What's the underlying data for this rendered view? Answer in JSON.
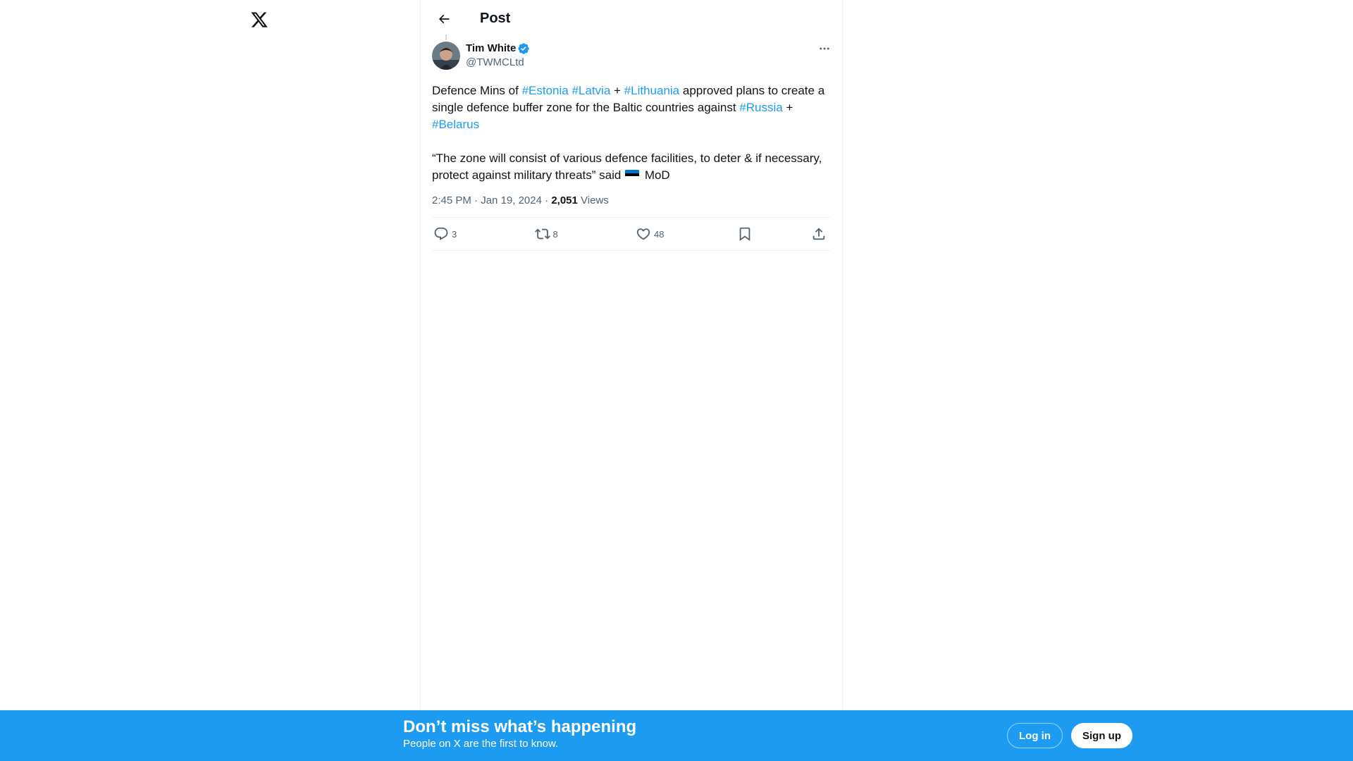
{
  "topbar": {
    "title": "Post"
  },
  "post": {
    "author": {
      "name": "Tim White",
      "handle": "@TWMCLtd"
    },
    "paragraph1": [
      {
        "text": "Defence Mins of ",
        "hashtag": false
      },
      {
        "text": "#Estonia",
        "hashtag": true
      },
      {
        "text": " ",
        "hashtag": false
      },
      {
        "text": "#Latvia",
        "hashtag": true
      },
      {
        "text": " + ",
        "hashtag": false
      },
      {
        "text": "#Lithuania",
        "hashtag": true
      },
      {
        "text": " approved plans to create a single defence buffer zone for the Baltic countries against ",
        "hashtag": false
      },
      {
        "text": "#Russia",
        "hashtag": true
      },
      {
        "text": " + ",
        "hashtag": false
      },
      {
        "text": "#Belarus",
        "hashtag": true
      }
    ],
    "paragraph2_before_flag": "“The zone will consist of various defence facilities, to deter & if necessary, protect against military threats” said",
    "paragraph2_after_flag": "MoD",
    "flag_colors": [
      "#0072ce",
      "#000000",
      "#ffffff"
    ],
    "time": "2:45 PM",
    "separator": "·",
    "date": "Jan 19, 2024",
    "views_count": "2,051",
    "views_label": "Views",
    "actions": {
      "replies": "3",
      "reposts": "8",
      "likes": "48"
    }
  },
  "banner": {
    "title": "Don’t miss what’s happening",
    "subtitle": "People on X are the first to know.",
    "login_label": "Log in",
    "signup_label": "Sign up"
  },
  "colors": {
    "accent": "#1d9bf0",
    "text": "#0f1419",
    "secondary": "#536471"
  },
  "icons": [
    "x-logo-icon",
    "back-arrow-icon",
    "verified-badge-icon",
    "more-icon",
    "reply-icon",
    "repost-icon",
    "like-icon",
    "bookmark-icon",
    "share-icon"
  ]
}
